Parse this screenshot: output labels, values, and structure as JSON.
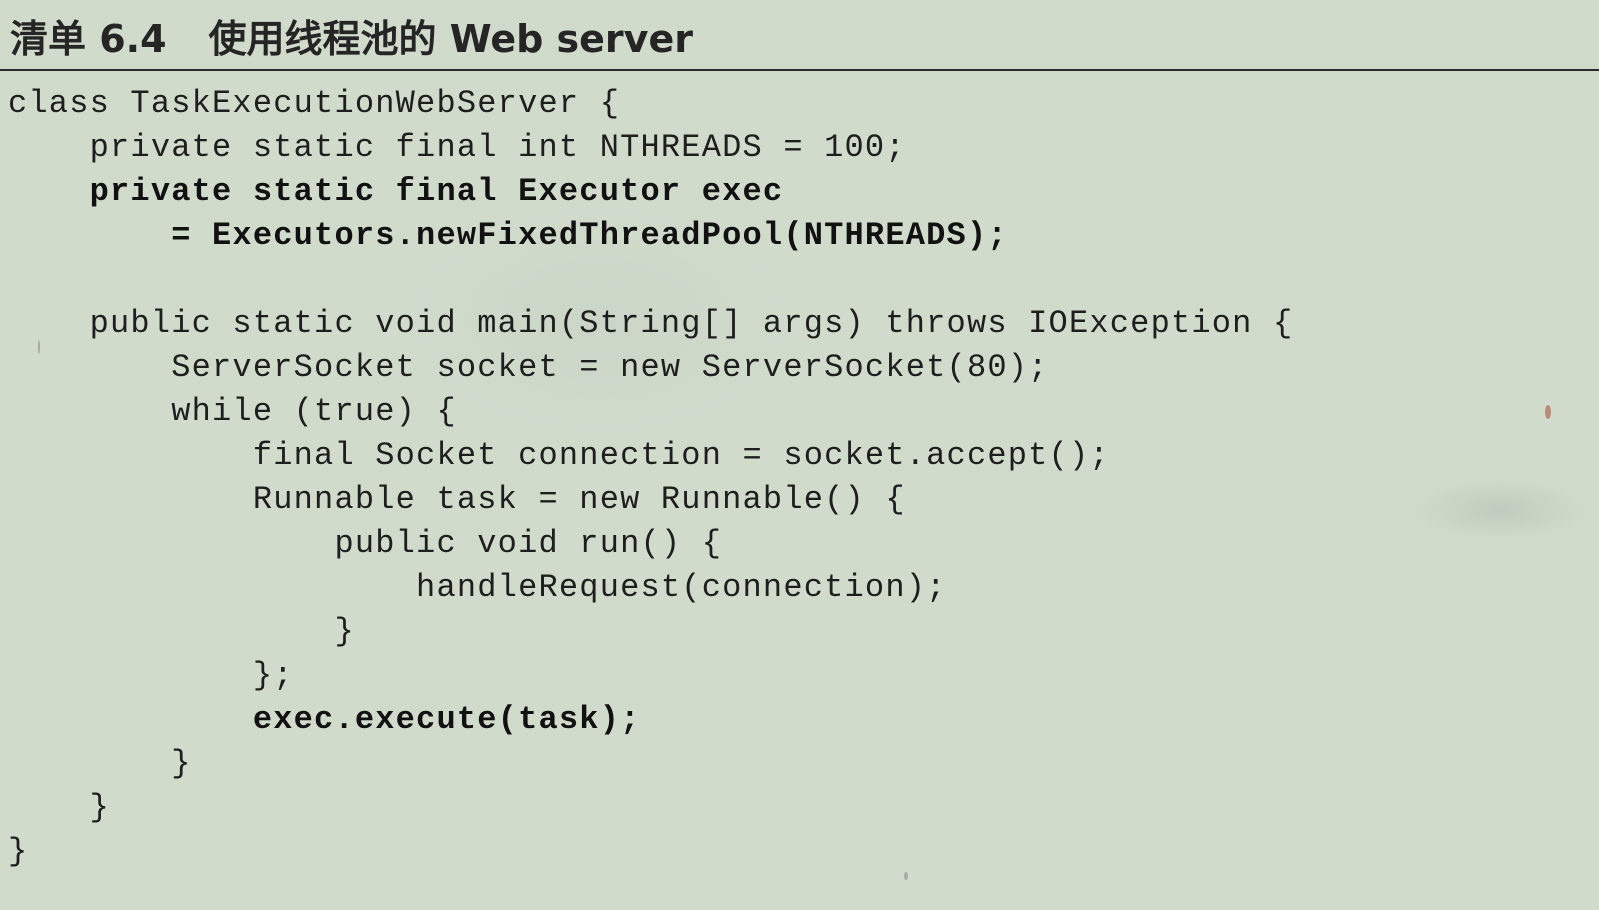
{
  "listing": {
    "label": "清单 6.4",
    "title": "使用线程池的 Web server"
  },
  "code": {
    "lines": [
      {
        "text": "class TaskExecutionWebServer {",
        "bold": false
      },
      {
        "text": "    private static final int NTHREADS = 100;",
        "bold": false
      },
      {
        "text": "    private static final Executor exec",
        "bold": true
      },
      {
        "text": "        = Executors.newFixedThreadPool(NTHREADS);",
        "bold": true
      },
      {
        "text": "",
        "bold": false
      },
      {
        "text": "    public static void main(String[] args) throws IOException {",
        "bold": false
      },
      {
        "text": "        ServerSocket socket = new ServerSocket(80);",
        "bold": false
      },
      {
        "text": "        while (true) {",
        "bold": false
      },
      {
        "text": "            final Socket connection = socket.accept();",
        "bold": false
      },
      {
        "text": "            Runnable task = new Runnable() {",
        "bold": false
      },
      {
        "text": "                public void run() {",
        "bold": false
      },
      {
        "text": "                    handleRequest(connection);",
        "bold": false
      },
      {
        "text": "                }",
        "bold": false
      },
      {
        "text": "            };",
        "bold": false
      },
      {
        "text": "            exec.execute(task);",
        "bold": true
      },
      {
        "text": "        }",
        "bold": false
      },
      {
        "text": "    }",
        "bold": false
      },
      {
        "text": "}",
        "bold": false
      }
    ]
  }
}
